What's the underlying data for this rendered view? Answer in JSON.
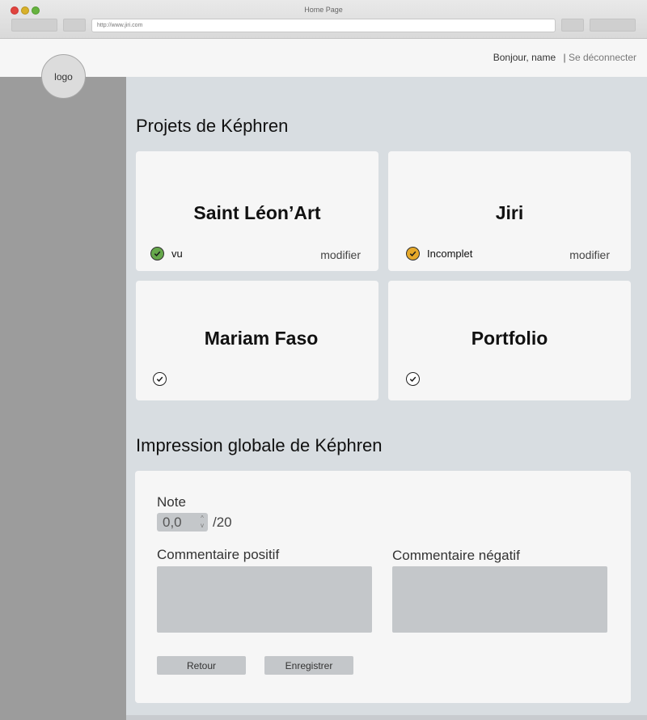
{
  "browser": {
    "window_title": "Home Page",
    "url": "http://www.jiri.com"
  },
  "header": {
    "greeting": "Bonjour, name",
    "separator": "|",
    "logout_label": "Se déconnecter",
    "logo_label": "logo"
  },
  "projects": {
    "heading": "Projets de Képhren",
    "cards": [
      {
        "title": "Saint Léon’Art",
        "status_icon": "check-circle-green",
        "status_label": "vu",
        "action_label": "modifier"
      },
      {
        "title": "Jiri",
        "status_icon": "check-circle-orange",
        "status_label": "Incomplet",
        "action_label": "modifier"
      },
      {
        "title": "Mariam Faso",
        "status_icon": "check-circle-outline"
      },
      {
        "title": "Portfolio",
        "status_icon": "check-circle-outline"
      }
    ]
  },
  "impression": {
    "heading": "Impression globale de Képhren",
    "note_label": "Note",
    "note_value": "0,0",
    "note_max": "/20",
    "positive_label": "Commentaire positif",
    "negative_label": "Commentaire négatif",
    "back_label": "Retour",
    "save_label": "Enregistrer"
  },
  "colors": {
    "status_ok": "#66a84b",
    "status_incomplete": "#e6a92a",
    "sidebar": "#9c9c9c",
    "content_bg": "#d8dde1"
  }
}
